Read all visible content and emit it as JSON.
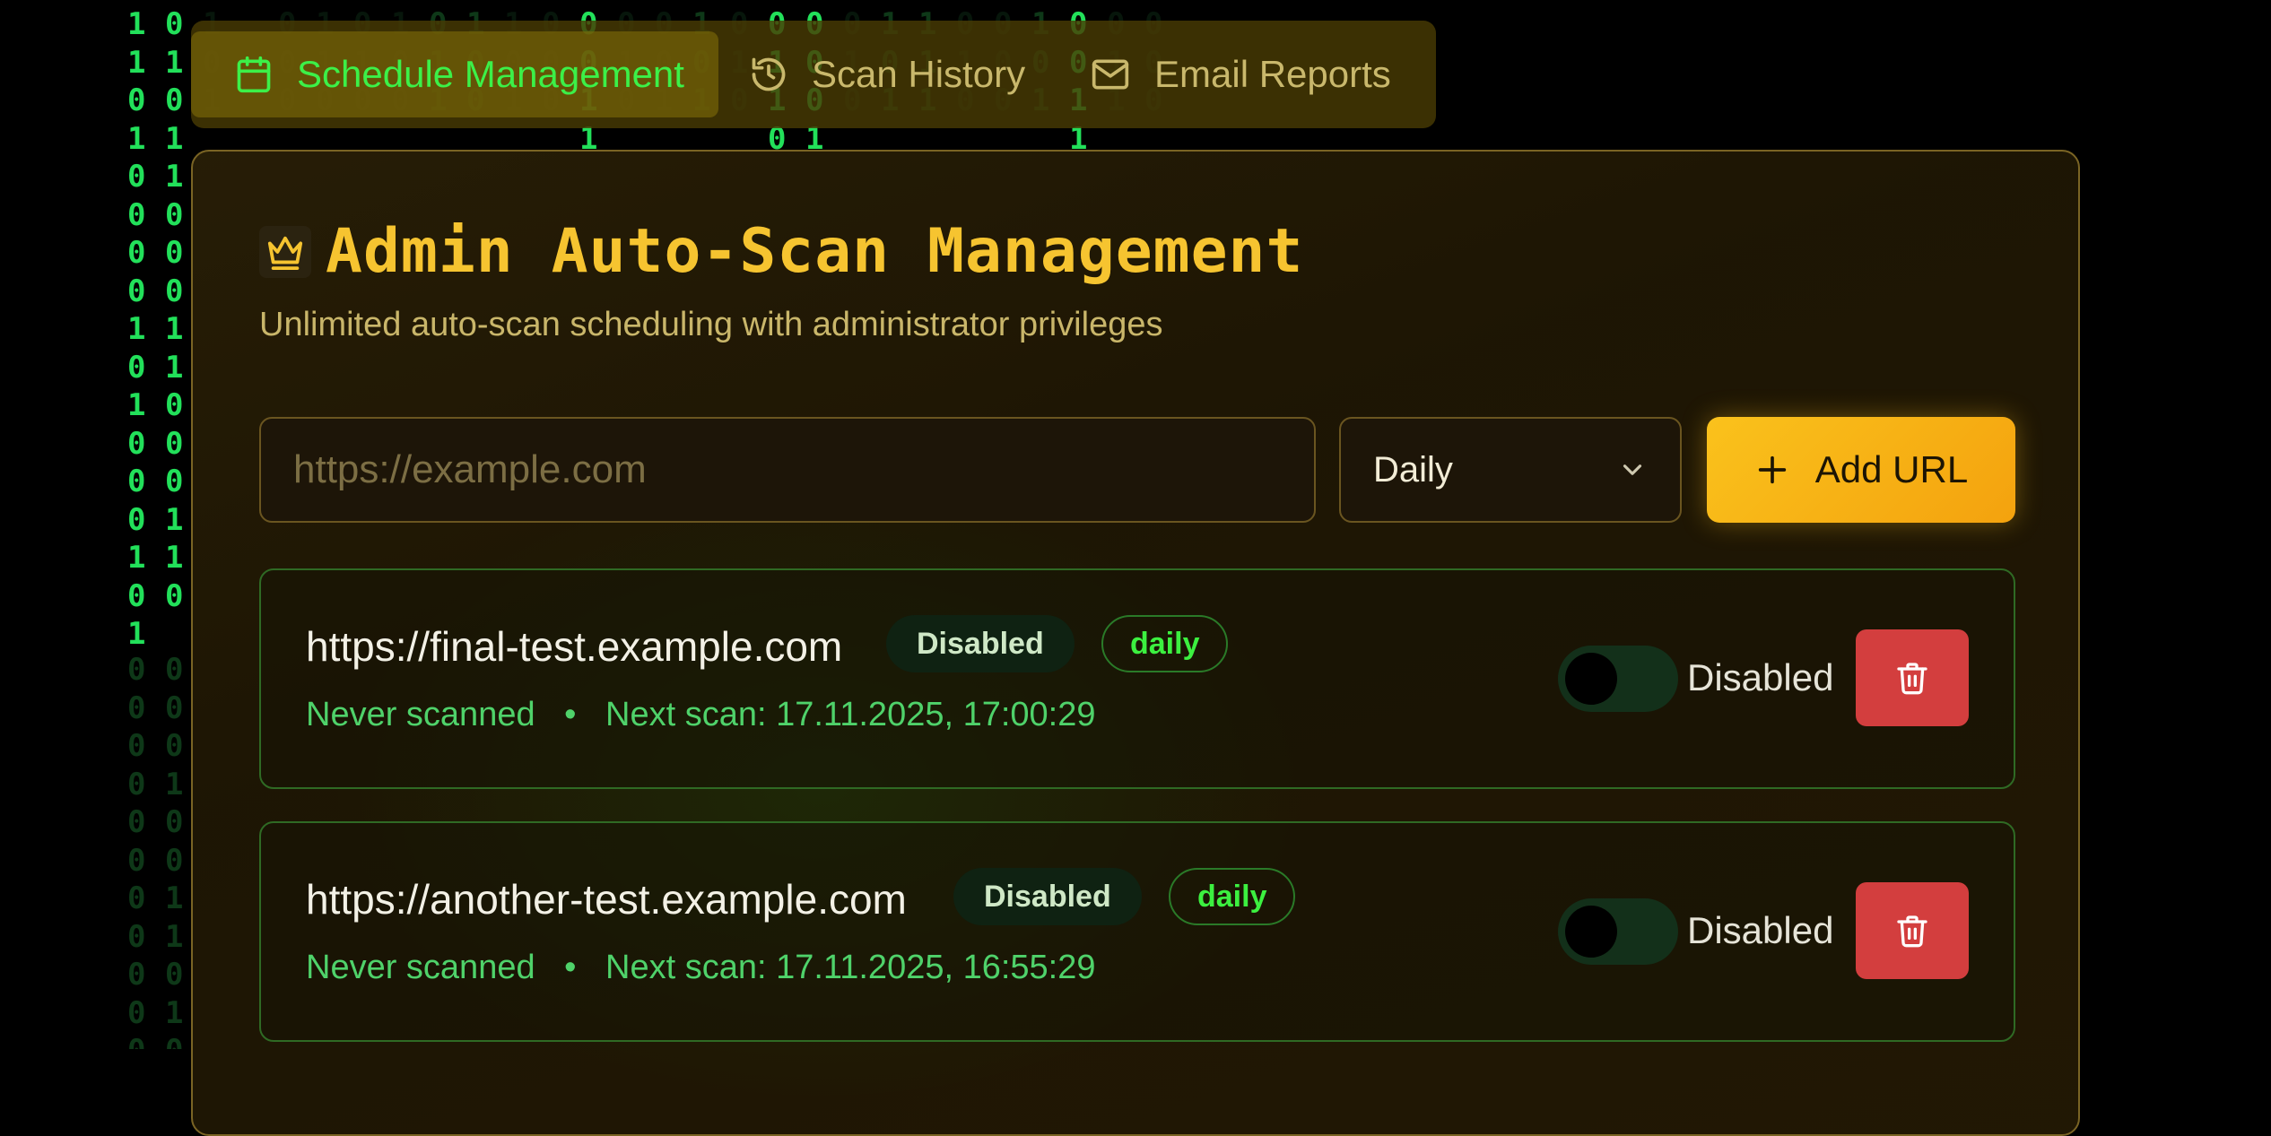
{
  "tabs": [
    {
      "label": "Schedule Management",
      "icon": "calendar-icon",
      "active": true
    },
    {
      "label": "Scan History",
      "icon": "history-icon",
      "active": false
    },
    {
      "label": "Email Reports",
      "icon": "mail-icon",
      "active": false
    }
  ],
  "panel": {
    "title": "Admin Auto-Scan Management",
    "subtitle": "Unlimited auto-scan scheduling with administrator privileges",
    "icon": "crown-icon"
  },
  "form": {
    "url_placeholder": "https://example.com",
    "frequency_selected": "Daily",
    "add_label": "Add URL"
  },
  "schedules": [
    {
      "url": "https://final-test.example.com",
      "status_badge": "Disabled",
      "frequency": "daily",
      "last_scan": "Never scanned",
      "separator": "•",
      "next_scan": "Next scan: 17.11.2025, 17:00:29",
      "toggle_label": "Disabled",
      "enabled": false
    },
    {
      "url": "https://another-test.example.com",
      "status_badge": "Disabled",
      "frequency": "daily",
      "last_scan": "Never scanned",
      "separator": "•",
      "next_scan": "Next scan: 17.11.2025, 16:55:29",
      "toggle_label": "Disabled",
      "enabled": false
    }
  ],
  "colors": {
    "accent_gold": "#f6c430",
    "matrix_green": "#22e05a",
    "delete_red": "#d33e3e"
  }
}
